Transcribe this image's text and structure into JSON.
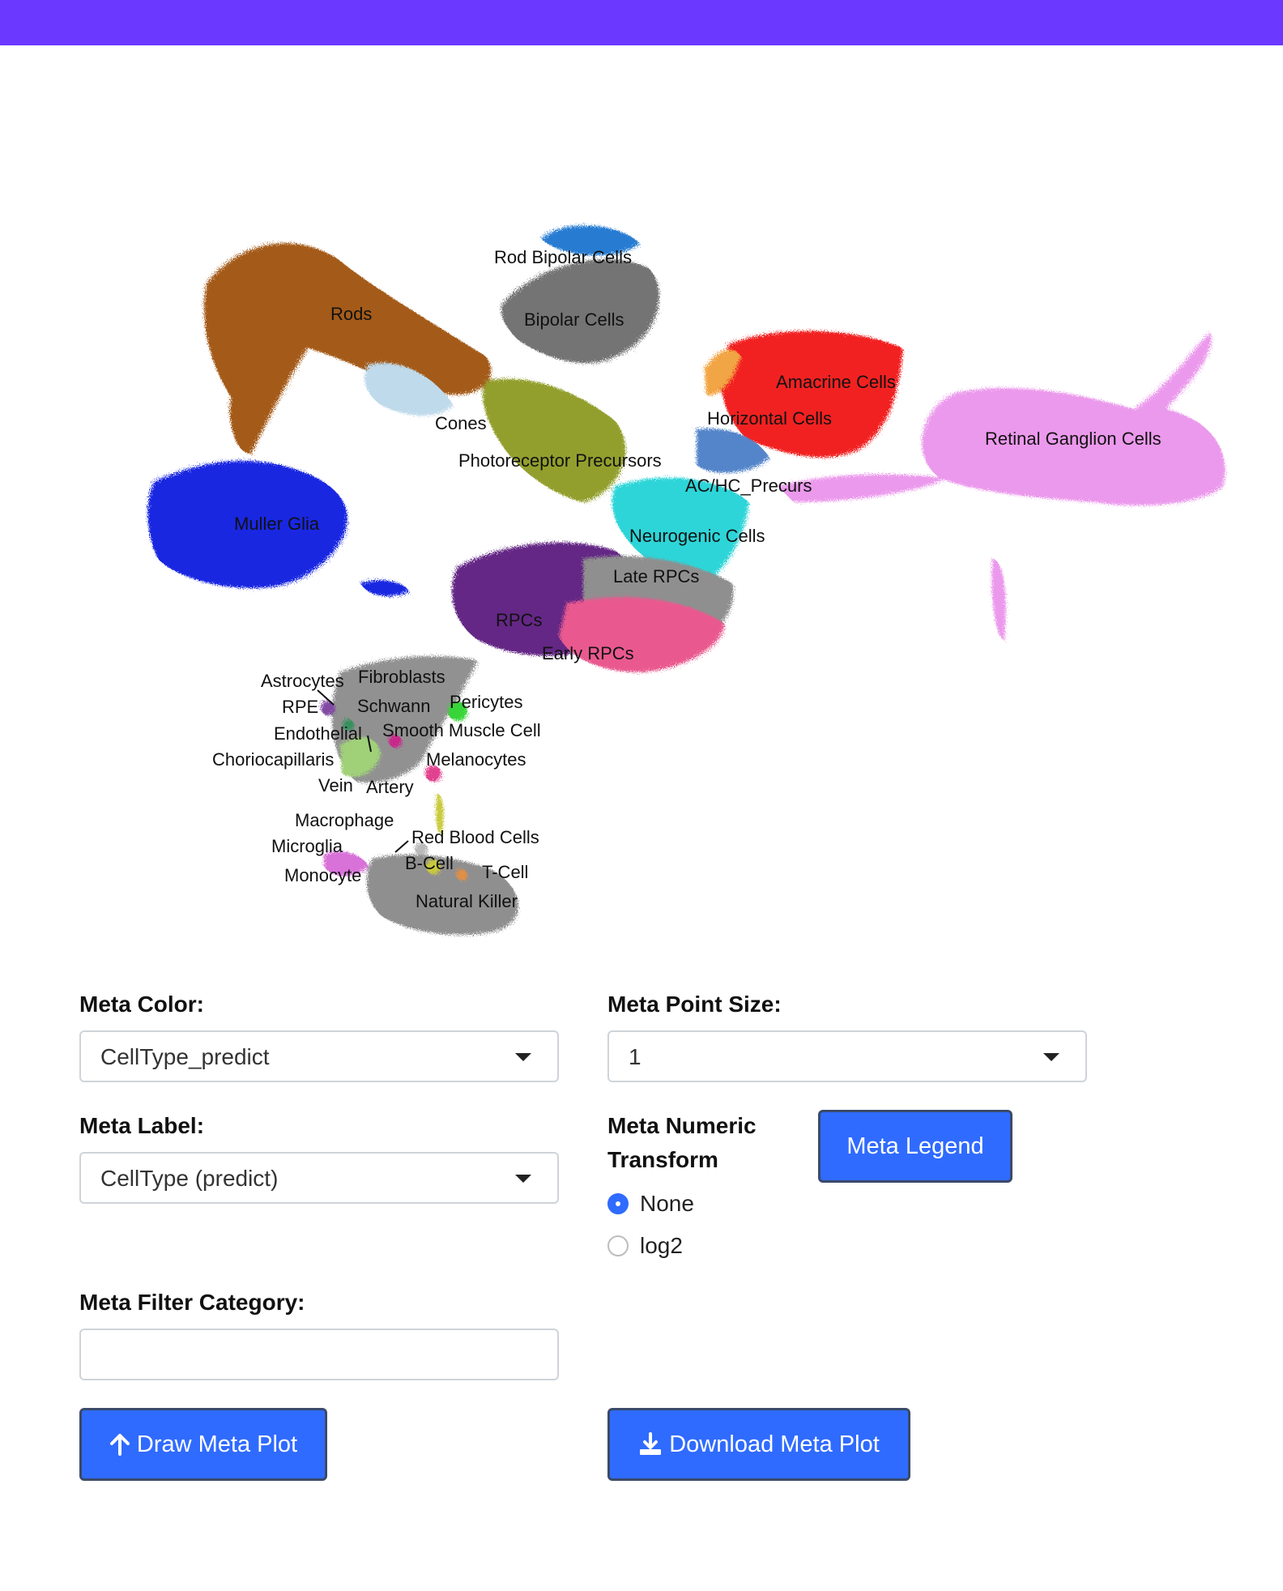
{
  "header": {
    "color": "#6a38ff"
  },
  "umap": {
    "labels": {
      "rod_bipolar": "Rod Bipolar Cells",
      "rods": "Rods",
      "bipolar": "Bipolar Cells",
      "amacrine": "Amacrine Cells",
      "cones": "Cones",
      "horizontal": "Horizontal Cells",
      "rgc": "Retinal Ganglion Cells",
      "photoreceptor_precursors": "Photoreceptor Precursors",
      "achc": "AC/HC_Precurs",
      "muller": "Muller Glia",
      "neurogenic": "Neurogenic Cells",
      "late_rpcs": "Late RPCs",
      "rpcs": "RPCs",
      "early_rpcs": "Early RPCs",
      "astrocytes": "Astrocytes",
      "fibroblasts": "Fibroblasts",
      "rpe": "RPE",
      "schwann": "Schwann",
      "pericytes": "Pericytes",
      "endothelial": "Endothelial",
      "smooth_muscle": "Smooth Muscle Cell",
      "choriocapillaris": "Choriocapillaris",
      "melanocytes": "Melanocytes",
      "vein": "Vein",
      "artery": "Artery",
      "macrophage": "Macrophage",
      "red_blood": "Red Blood Cells",
      "microglia": "Microglia",
      "b_cell": "B-Cell",
      "monocyte": "Monocyte",
      "t_cell": "T-Cell",
      "nk": "Natural Killer"
    }
  },
  "controls": {
    "meta_color_label": "Meta Color:",
    "meta_color_value": "CellType_predict",
    "meta_point_size_label": "Meta Point Size:",
    "meta_point_size_value": "1",
    "meta_label_label": "Meta Label:",
    "meta_label_value": "CellType (predict)",
    "numeric_transform_label_1": "Meta Numeric",
    "numeric_transform_label_2": "Transform",
    "legend_button": "Meta Legend",
    "radio_none": "None",
    "radio_log2": "log2",
    "filter_category_label": "Meta Filter Category:",
    "filter_category_value": "",
    "draw_button": "Draw Meta Plot",
    "download_button": "Download Meta Plot"
  }
}
